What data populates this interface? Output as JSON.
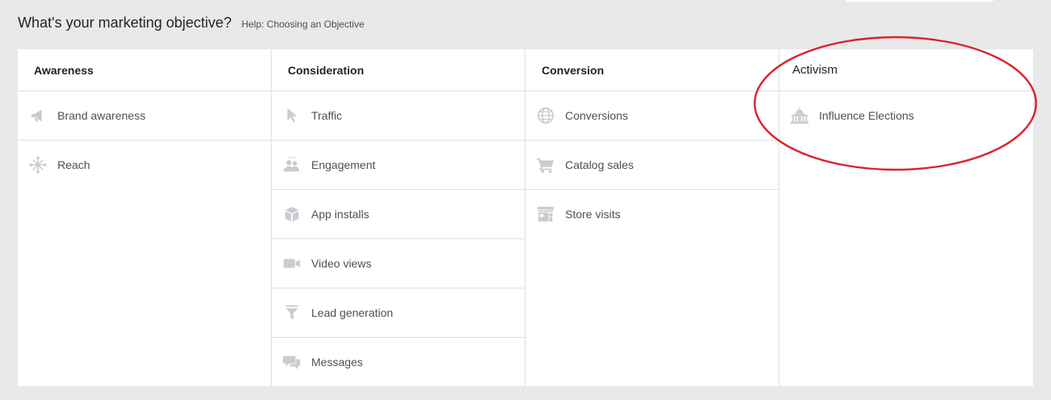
{
  "header": {
    "title": "What's your marketing objective?",
    "help": "Help: Choosing an Objective"
  },
  "columns": [
    {
      "title": "Awareness",
      "items": [
        {
          "label": "Brand awareness",
          "icon": "megaphone-icon"
        },
        {
          "label": "Reach",
          "icon": "reach-icon"
        }
      ]
    },
    {
      "title": "Consideration",
      "items": [
        {
          "label": "Traffic",
          "icon": "cursor-icon"
        },
        {
          "label": "Engagement",
          "icon": "people-icon"
        },
        {
          "label": "App installs",
          "icon": "box-icon"
        },
        {
          "label": "Video views",
          "icon": "video-camera-icon"
        },
        {
          "label": "Lead generation",
          "icon": "funnel-icon"
        },
        {
          "label": "Messages",
          "icon": "chat-bubbles-icon"
        }
      ]
    },
    {
      "title": "Conversion",
      "items": [
        {
          "label": "Conversions",
          "icon": "globe-icon"
        },
        {
          "label": "Catalog sales",
          "icon": "shopping-cart-icon"
        },
        {
          "label": "Store visits",
          "icon": "storefront-icon"
        }
      ]
    },
    {
      "title": "Activism",
      "items": [
        {
          "label": "Influence Elections",
          "icon": "capitol-building-icon"
        }
      ]
    }
  ],
  "colors": {
    "background": "#e9e9e9",
    "panel": "#ffffff",
    "divider": "#dddfe2",
    "icon": "#c9ccd1",
    "callout": "#d9232a"
  }
}
